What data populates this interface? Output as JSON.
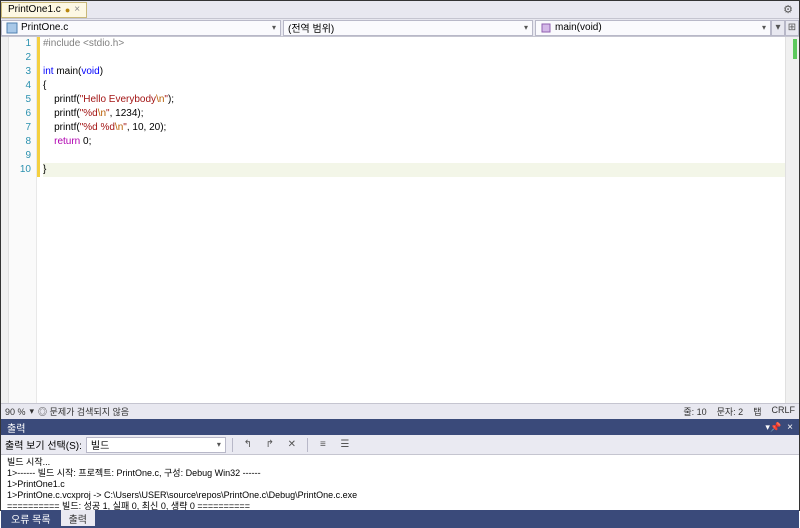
{
  "tab": {
    "title": "PrintOne1.c",
    "modified": "●",
    "close": "×"
  },
  "nav": {
    "file": "PrintOne.c",
    "scope": "(전역 범위)",
    "member": "main(void)"
  },
  "code": {
    "lines": [
      "1",
      "2",
      "3",
      "4",
      "5",
      "6",
      "7",
      "8",
      "9",
      "10"
    ],
    "l1_pp": "#include ",
    "l1_inc": "<stdio.h>",
    "l3_kw1": "int ",
    "l3_fn": "main(",
    "l3_kw2": "void",
    "l3_end": ")",
    "l4": "{",
    "l5_call": "    printf(",
    "l5_str": "\"Hello Everybody",
    "l5_esc": "\\n",
    "l5_strend": "\"",
    "l5_end": ");",
    "l6_call": "    printf(",
    "l6_str": "\"%d",
    "l6_esc": "\\n",
    "l6_strend": "\"",
    "l6_args": ", 1234);",
    "l7_call": "    printf(",
    "l7_str": "\"%d %d",
    "l7_esc": "\\n",
    "l7_strend": "\"",
    "l7_args": ", 10, 20);",
    "l8_ret": "    return ",
    "l8_val": "0;",
    "l10": "}"
  },
  "status": {
    "zoom": "90 %",
    "issues": "◎ 문제가 검색되지 않음",
    "line": "줄: 10",
    "char": "문자: 2",
    "tab": "탭",
    "crlf": "CRLF"
  },
  "output": {
    "title": "출력",
    "label": "출력 보기 선택(S):",
    "source": "빌드",
    "lines": [
      "빌드 시작...",
      "1>------ 빌드 시작: 프로젝트: PrintOne.c, 구성: Debug Win32 ------",
      "1>PrintOne1.c",
      "1>PrintOne.c.vcxproj -> C:\\Users\\USER\\source\\repos\\PrintOne.c\\Debug\\PrintOne.c.exe",
      "========== 빌드: 성공 1, 실패 0, 최신 0, 생략 0 =========="
    ]
  },
  "bottomTabs": {
    "errors": "오류 목록",
    "output": "출력"
  }
}
